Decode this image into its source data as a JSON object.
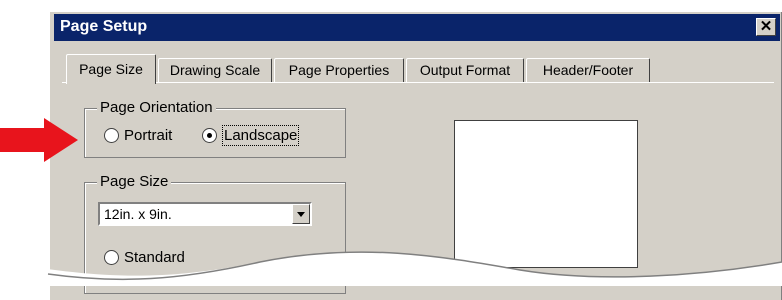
{
  "window": {
    "title": "Page Setup",
    "close_glyph": "✕"
  },
  "tabs": [
    {
      "label": "Page Size",
      "active": true
    },
    {
      "label": "Drawing Scale",
      "active": false
    },
    {
      "label": "Page Properties",
      "active": false
    },
    {
      "label": "Output Format",
      "active": false
    },
    {
      "label": "Header/Footer",
      "active": false
    }
  ],
  "orientation": {
    "legend": "Page Orientation",
    "portrait_label": "Portrait",
    "landscape_label": "Landscape",
    "selected": "Landscape"
  },
  "page_size": {
    "legend": "Page Size",
    "selected_value": "12in. x 9in.",
    "partial_option_label": "Standard"
  },
  "colors": {
    "titlebar": "#0a246a",
    "dialog": "#d4d0c8",
    "arrow": "#e8141c"
  },
  "icons": {
    "close": "close-icon",
    "dropdown": "chevron-down-icon",
    "pointer": "red-arrow-icon"
  }
}
